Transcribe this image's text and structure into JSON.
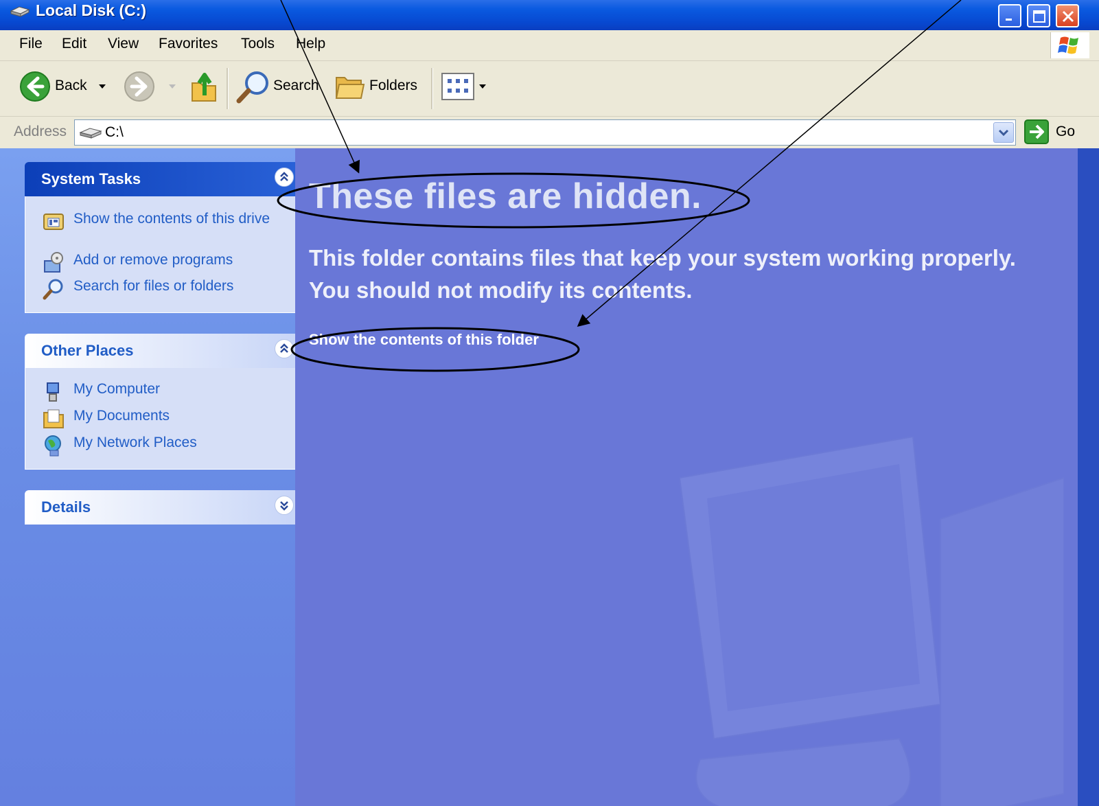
{
  "window": {
    "title": "Local Disk (C:)",
    "controls": [
      "minimize-icon",
      "maximize-icon",
      "close-icon"
    ]
  },
  "menubar": {
    "items": [
      "File",
      "Edit",
      "View",
      "Favorites",
      "Tools",
      "Help"
    ]
  },
  "toolbar": {
    "back_label": "Back",
    "search_label": "Search",
    "folders_label": "Folders",
    "icons": [
      "back-arrow-icon",
      "forward-arrow-icon",
      "up-folder-icon",
      "search-magnifier-icon",
      "folders-icon",
      "views-icon"
    ]
  },
  "address": {
    "label": "Address",
    "value": "C:\\",
    "go_label": "Go"
  },
  "sidebar": {
    "system_tasks": {
      "title": "System Tasks",
      "items": [
        "Show the contents of this drive",
        "Add or remove programs",
        "Search for files or folders"
      ]
    },
    "other_places": {
      "title": "Other Places",
      "items": [
        "My Computer",
        "My Documents",
        "My Network Places"
      ]
    },
    "details": {
      "title": "Details"
    }
  },
  "main": {
    "title": "These files are hidden.",
    "message_line1": "This folder contains files that keep your system working properly.",
    "message_line2": "You should not modify its contents.",
    "link": "Show the contents of this folder"
  },
  "colors": {
    "titlebar": "#0a5ae0",
    "sidebar_link": "#215dc6",
    "main_background": "#6977d7",
    "annotation_background": "#ffff99"
  }
}
